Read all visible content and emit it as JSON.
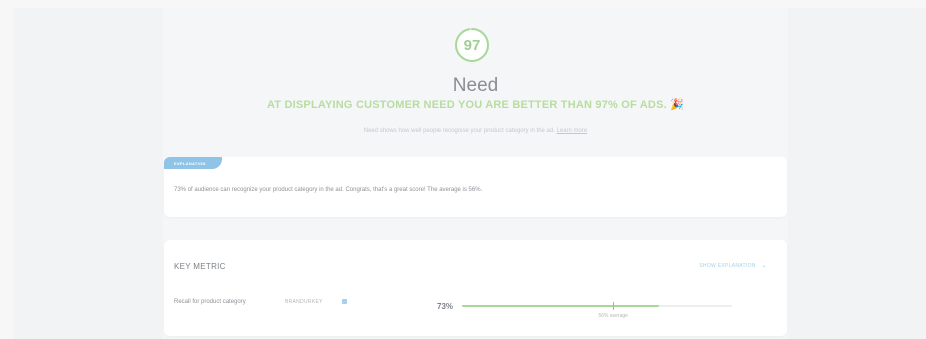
{
  "score": {
    "value": "97",
    "ring_fraction": 0.97,
    "ring_color": "#a7d89a"
  },
  "section_title": "Need",
  "headline": "AT DISPLAYING CUSTOMER NEED YOU ARE BETTER THAN 97% OF ADS. 🎉",
  "subtext": {
    "text": "Need shows how well people recognise your product category in the ad. ",
    "link": "Learn more"
  },
  "explanation": {
    "badge": "EXPLANATION",
    "text": "73% of audience can recognize your product category in the ad. Congrats, that's a great score! The average is 56%."
  },
  "key_metric": {
    "title": "KEY METRIC",
    "show_explanation": "SHOW EXPLANATION",
    "chevron_icon": "chevron-down-icon",
    "label": "Recall for product category",
    "brand": "BRANDURKEY",
    "value_text": "73%",
    "value_fraction": 0.73,
    "average_fraction": 0.56,
    "average_label": "56% average",
    "accent": "#a7d89a"
  }
}
